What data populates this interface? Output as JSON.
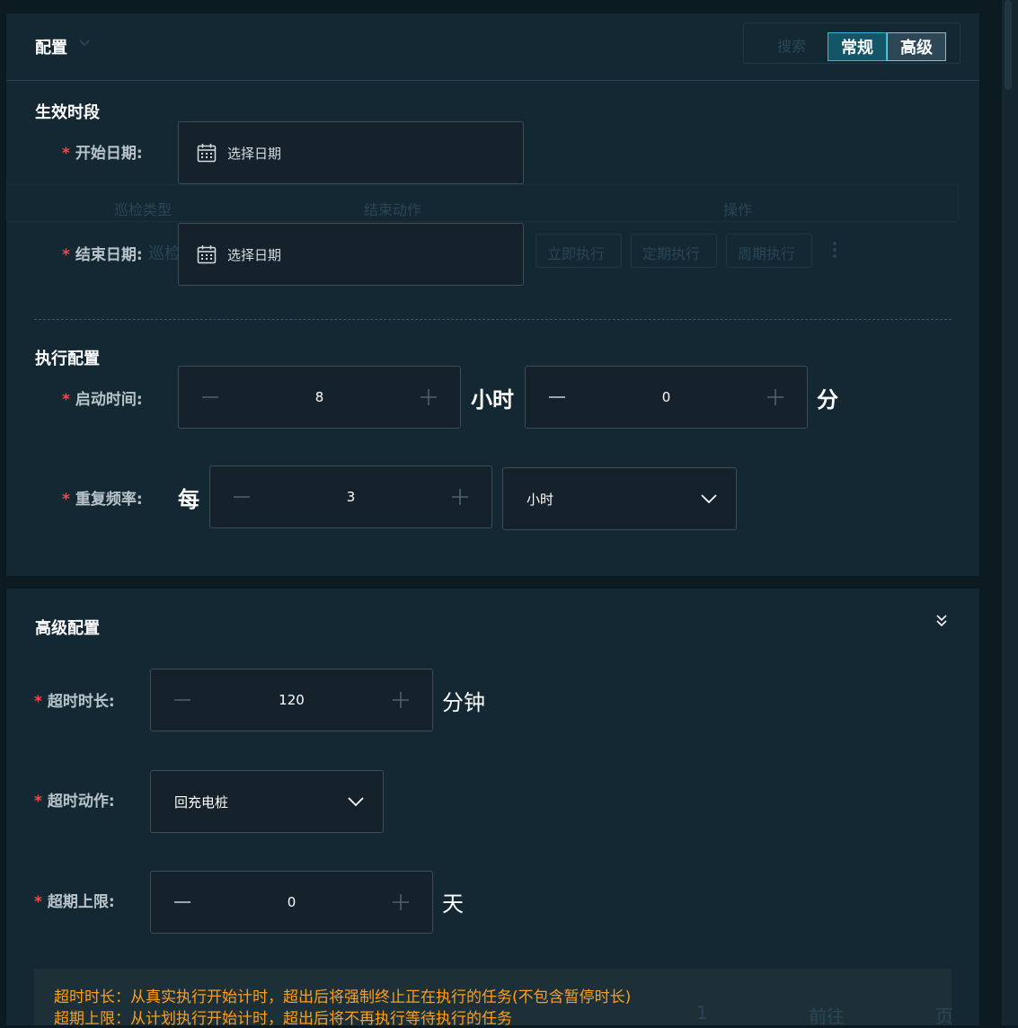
{
  "config": {
    "title": "配置",
    "mode_buttons": {
      "normal": "常规",
      "advanced": "高级"
    },
    "ghost_background": {
      "search": "搜索",
      "col_type": "巡检类型",
      "col_end_action": "结束动作",
      "col_ops": "操作",
      "row_text": "巡检",
      "btn_run_now": "立即执行",
      "btn_scheduled": "定期执行",
      "btn_periodic": "周期执行"
    },
    "effective_period": {
      "title": "生效时段",
      "start_date": {
        "label": "开始日期:",
        "placeholder": "选择日期"
      },
      "end_date": {
        "label": "结束日期:",
        "placeholder": "选择日期"
      }
    },
    "execution": {
      "title": "执行配置",
      "start_time": {
        "label": "启动时间:",
        "hour": "8",
        "hour_unit": "小时",
        "minute": "0",
        "minute_unit": "分"
      },
      "repeat": {
        "label": "重复频率:",
        "prefix": "每",
        "value": "3",
        "unit": "小时"
      }
    }
  },
  "advanced": {
    "title": "高级配置",
    "timeout_duration": {
      "label": "超时时长:",
      "value": "120",
      "unit": "分钟"
    },
    "timeout_action": {
      "label": "超时动作:",
      "value": "回充电桩"
    },
    "overdue_limit": {
      "label": "超期上限:",
      "value": "0",
      "unit": "天"
    },
    "notes": [
      "超时时长：从真实执行开始计时，超出后将强制终止正在执行的任务(不包含暂停时长)",
      "超期上限：从计划执行开始计时，超出后将不再执行等待执行的任务"
    ]
  },
  "ghost_pagination": {
    "page": "1",
    "goto": "前往",
    "page_suffix": "页"
  },
  "colors": {
    "accent": "#3bb5d0",
    "required": "#f5474a",
    "note_text": "#ff9f1c",
    "background": "#0c1a22",
    "panel": "#132832"
  }
}
